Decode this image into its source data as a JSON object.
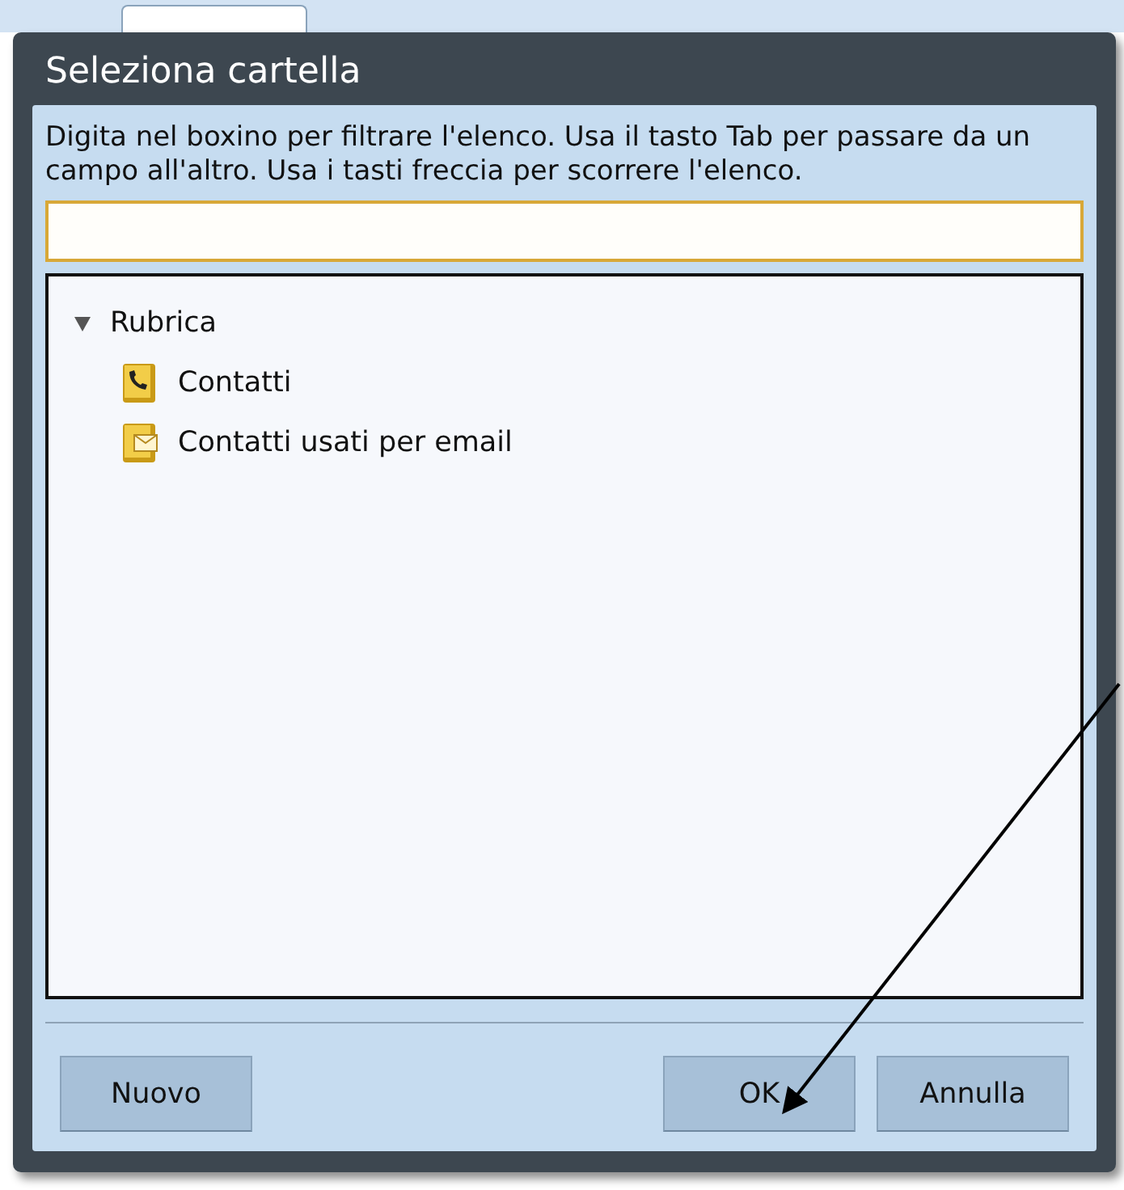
{
  "dialog": {
    "title": "Seleziona cartella",
    "instructions": "Digita nel boxino per filtrare l'elenco. Usa il tasto Tab per passare da un campo all'altro. Usa i tasti freccia per scorrere l'elenco.",
    "filter": {
      "focused": true
    },
    "tree": [
      {
        "label": "Rubrica",
        "expanded": true,
        "children": [
          {
            "label": "Contatti",
            "kind": "phone-book"
          },
          {
            "label": "Contatti usati per email",
            "kind": "mail-book"
          }
        ]
      }
    ],
    "buttons": [
      {
        "label": "Nuovo",
        "kind": "left"
      },
      {
        "label": "OK",
        "kind": "right"
      },
      {
        "label": "Annulla",
        "kind": "right"
      }
    ]
  }
}
